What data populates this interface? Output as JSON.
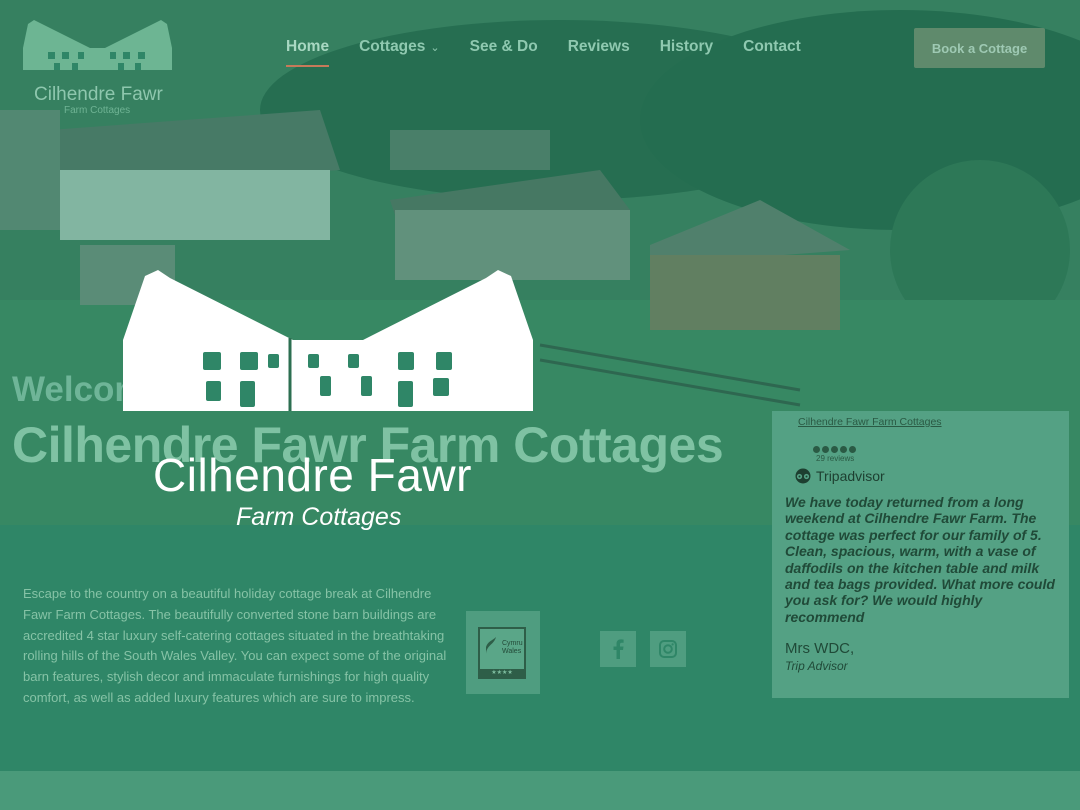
{
  "brand": {
    "name": "Cilhendre Fawr",
    "subtitle": "Farm Cottages"
  },
  "nav": {
    "items": [
      {
        "label": "Home",
        "active": true
      },
      {
        "label": "Cottages",
        "has_dropdown": true
      },
      {
        "label": "See & Do"
      },
      {
        "label": "Reviews"
      },
      {
        "label": "History"
      },
      {
        "label": "Contact"
      }
    ],
    "cta_label": "Book a Cottage"
  },
  "hero": {
    "welcome": "Welcome to",
    "title": "Cilhendre Fawr Farm Cottages",
    "logo_name": "Cilhendre Fawr",
    "logo_subtitle": "Farm Cottages"
  },
  "intro": {
    "text": "Escape to the country on a beautiful holiday cottage break at Cilhendre Fawr Farm Cottages. The beautifully converted stone barn buildings are accredited 4 star luxury self-catering cottages situated in the breathtaking rolling hills of the South Wales Valley.  You can expect some of the original barn features, stylish decor and immaculate furnishings for high quality comfort, as well as added luxury features which are sure to impress."
  },
  "badge": {
    "name": "Cymru Wales",
    "stars": "★★★★"
  },
  "social": {
    "facebook_icon": "facebook-icon",
    "instagram_icon": "instagram-icon"
  },
  "review": {
    "business_link": "Cilhendre Fawr Farm Cottages",
    "rating_bubbles": 5,
    "review_count": "29 reviews",
    "provider": "Tripadvisor",
    "quote": "We have today returned from a long weekend at Cilhendre Fawr Farm. The cottage was perfect for our family of 5. Clean, spacious, warm, with a vase of daffodils on the kitchen table and milk and tea bags provided. What more could you ask for? We would highly recommend",
    "author": "Mrs WDC,",
    "source": "Trip Advisor"
  },
  "colors": {
    "overlay": "#2f8667",
    "accent_underline": "#c77a5a",
    "button": "#5f8a6c"
  }
}
